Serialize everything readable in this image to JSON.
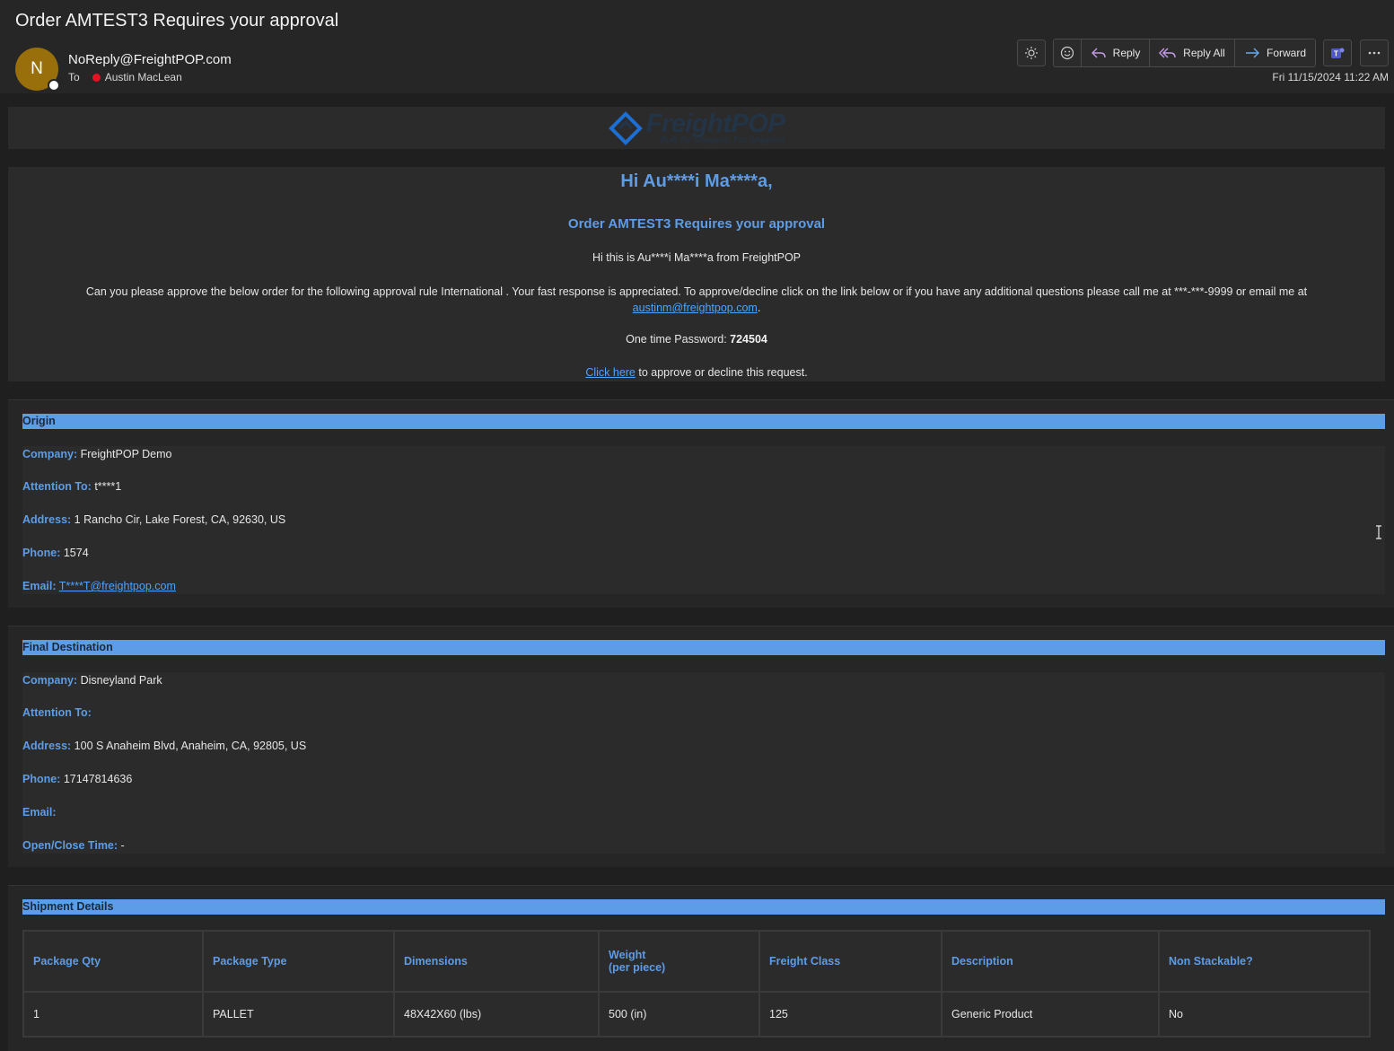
{
  "email": {
    "subject": "Order AMTEST3 Requires your approval",
    "avatar_initial": "N",
    "sender": "NoReply@FreightPOP.com",
    "to_label": "To",
    "recipient": "Austin MacLean",
    "date": "Fri 11/15/2024 11:22 AM"
  },
  "toolbar": {
    "reply": "Reply",
    "reply_all": "Reply All",
    "forward": "Forward",
    "icons": [
      "brightness-icon",
      "emoji-icon",
      "reply-icon",
      "reply-all-icon",
      "forward-icon",
      "teams-icon",
      "more-icon"
    ]
  },
  "logo": {
    "brand_a": "Freight",
    "brand_b": "POP",
    "tagline": "Built By Shippers, For Shippers"
  },
  "intro": {
    "greeting": "Hi Au****i Ma****a,",
    "title": "Order AMTEST3 Requires your approval",
    "line1": "Hi this is Au****i Ma****a from FreightPOP",
    "line2": "Can you please approve the below order for the following approval rule International . Your fast response is appreciated. To approve/decline click on the link below or if you have any additional questions please call me at ***-***-9999 or email me at",
    "email_link": "austinm@freightpop.com",
    "period": ".",
    "otp_label": "One time Password:",
    "otp_value": "724504",
    "click_here": "Click here",
    "click_rest": "to approve or decline this request."
  },
  "origin": {
    "heading": "Origin",
    "company_label": "Company:",
    "company": "FreightPOP Demo",
    "attention_label": "Attention To:",
    "attention": "t****1",
    "address_label": "Address:",
    "address": "1 Rancho Cir, Lake Forest, CA, 92630, US",
    "phone_label": "Phone:",
    "phone": "1574",
    "email_label": "Email:",
    "email": "T****T@freightpop.com"
  },
  "destination": {
    "heading": "Final Destination",
    "company_label": "Company:",
    "company": "Disneyland Park",
    "attention_label": "Attention To:",
    "attention": "",
    "address_label": "Address:",
    "address": "100 S Anaheim Blvd, Anaheim, CA, 92805, US",
    "phone_label": "Phone:",
    "phone": "17147814636",
    "email_label": "Email:",
    "email": "",
    "hours_label": "Open/Close Time:",
    "hours": "-"
  },
  "shipment": {
    "heading": "Shipment Details",
    "columns": [
      "Package Qty",
      "Package Type",
      "Dimensions",
      "Weight",
      "(per piece)",
      "Freight Class",
      "Description",
      "Non Stackable?"
    ],
    "row": [
      "1",
      "PALLET",
      "48X42X60 (lbs)",
      "500 (in)",
      "125",
      "Generic Product",
      "No"
    ]
  },
  "colors": {
    "accent": "#5d9ce6",
    "avatar": "#986f0b",
    "presence_busy": "#e81123",
    "link": "#4ea3ff"
  }
}
